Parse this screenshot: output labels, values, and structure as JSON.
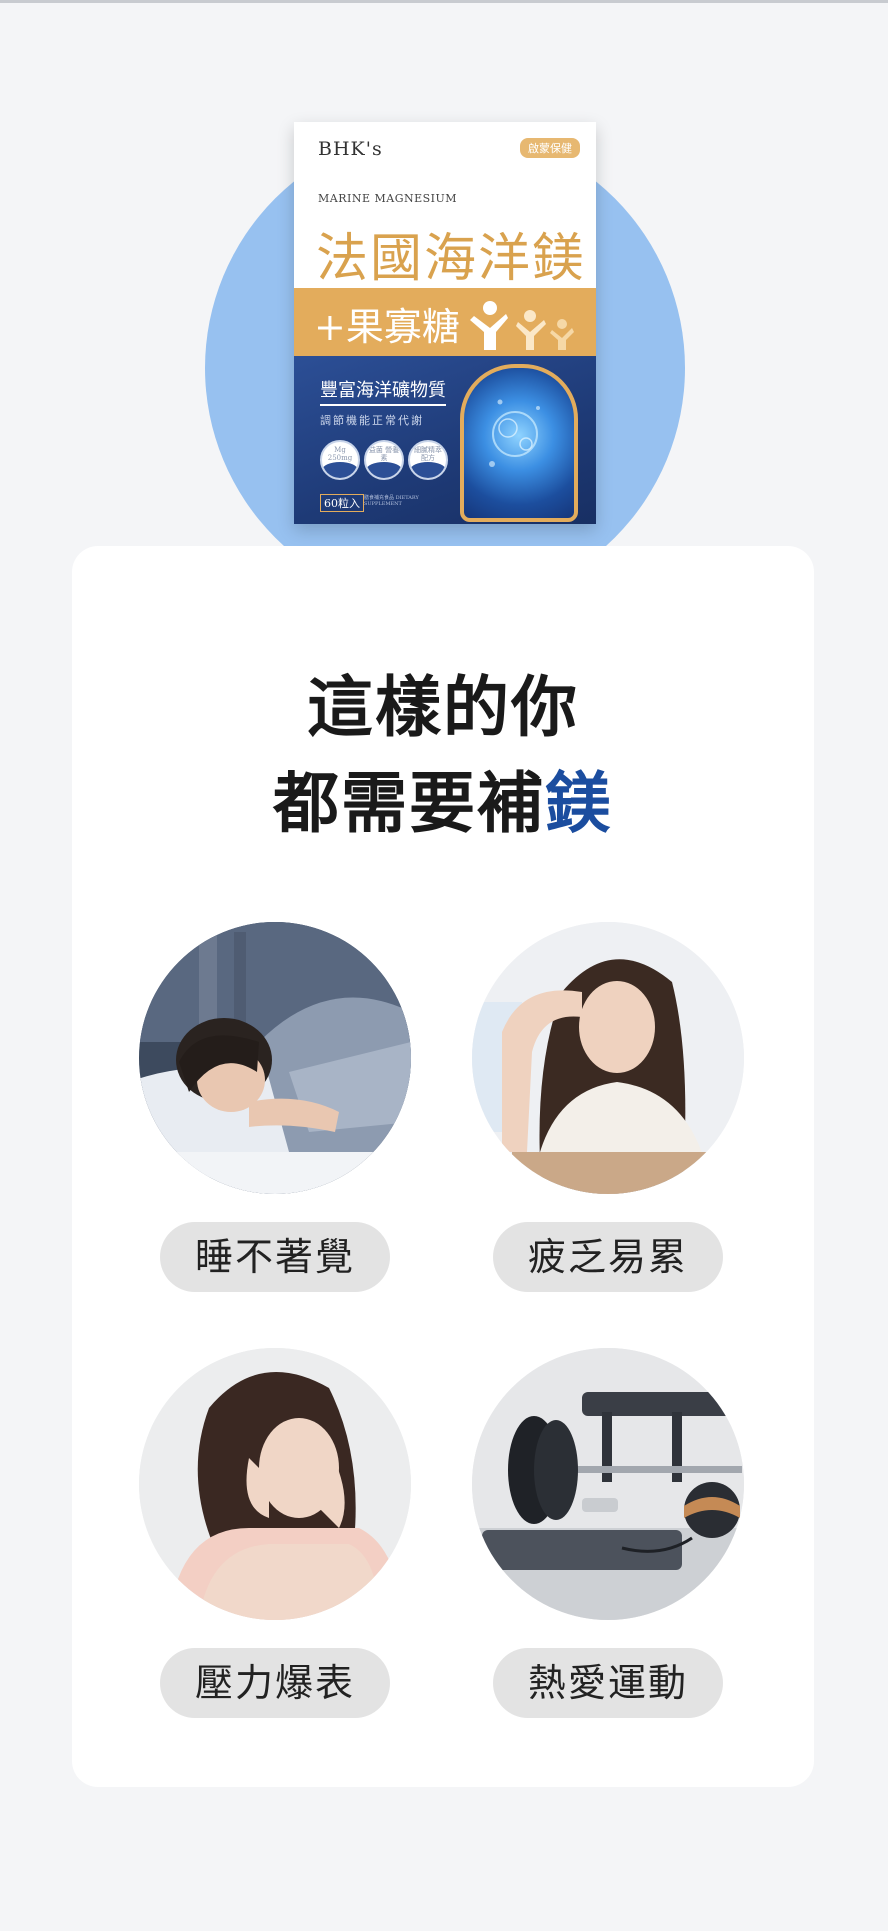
{
  "product": {
    "brand": "BHK's",
    "badge": "啟蒙保健",
    "subtitle": "MARINE MAGNESIUM",
    "title": "法國海洋鎂",
    "band_text": "+果寡糖",
    "mineral_line": "豐富海洋礦物質",
    "regulate_line": "調節機能正常代謝",
    "features": [
      "Mg 250mg",
      "益菌 營養素",
      "細膩精萃 配方"
    ],
    "count": "60粒入",
    "count_sub": "膳食補充食品 DIETARY SUPPLEMENT"
  },
  "headline": {
    "line1": "這樣的你",
    "line2_prefix": "都需要補",
    "line2_highlight": "鎂"
  },
  "items": [
    {
      "label": "睡不著覺",
      "icon": "sleepless-woman-photo"
    },
    {
      "label": "疲乏易累",
      "icon": "tired-woman-photo"
    },
    {
      "label": "壓力爆表",
      "icon": "stressed-woman-photo"
    },
    {
      "label": "熱愛運動",
      "icon": "gym-equipment-photo"
    }
  ],
  "colors": {
    "accent_blue": "#1b4d9f",
    "hero_circle": "#97c1f0",
    "gold": "#e3ac5c",
    "pill_bg": "#e3e3e3"
  }
}
